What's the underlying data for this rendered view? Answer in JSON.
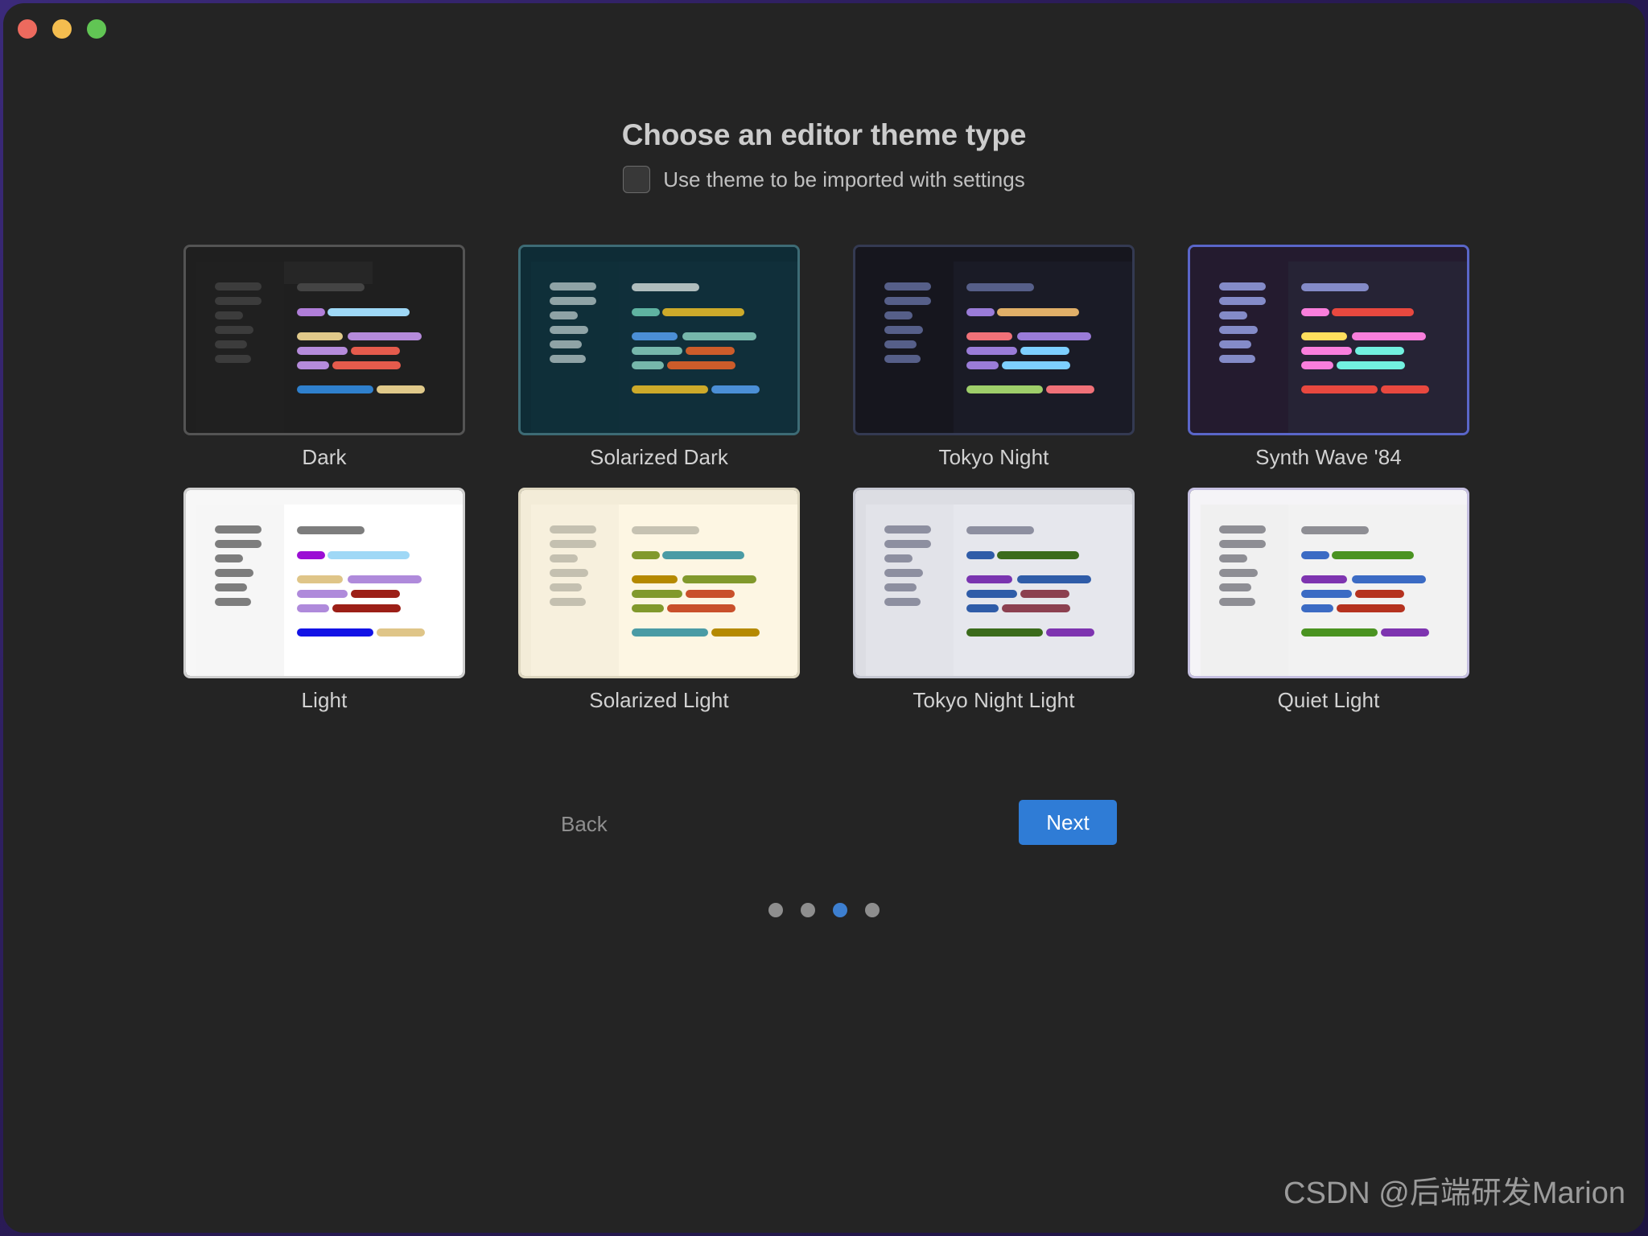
{
  "window": {
    "traffic_lights": [
      {
        "name": "close",
        "color": "#ed6a5e"
      },
      {
        "name": "minimize",
        "color": "#f4bd4f"
      },
      {
        "name": "zoom",
        "color": "#61c554"
      }
    ],
    "background": "#242424"
  },
  "header": {
    "title": "Choose an editor theme type",
    "import_label": "Use theme to be imported with settings",
    "import_checked": false
  },
  "themes": [
    {
      "label": "Dark",
      "selected": false,
      "chrome": false,
      "colors": {
        "bg": "#1f1f1f",
        "titlebar": "#1f1f1f",
        "activitybar": "#1f1f1f",
        "sidebar": "#202020",
        "editor": "#1f1f1f",
        "tab": "#262626",
        "line": "#2d2d2d",
        "border": "#545454",
        "sidebar_bar": "#3c3c3c",
        "tab_bar": "#444444"
      },
      "code": [
        [
          "#b07ed8",
          "#9fd8f6"
        ],
        [
          "#e0c98a",
          "#b58bdb"
        ],
        [
          "#b58bdb",
          "#e55b4c"
        ],
        [
          "#b58bdb",
          "#e55b4c"
        ],
        [
          "#2f80cd",
          "#e0c98a"
        ]
      ]
    },
    {
      "label": "Solarized Dark",
      "selected": false,
      "chrome": true,
      "colors": {
        "bg": "#10303b",
        "titlebar": "#0e2c36",
        "activitybar": "#0e2c36",
        "sidebar": "#0f2f39",
        "editor": "#102f3a",
        "tab": "#0e2c36",
        "line": "#204854",
        "border": "#3d6b75",
        "sidebar_bar": "#8fa3a6",
        "tab_bar": "#b0bdbd"
      },
      "code": [
        [
          "#5fb3a1",
          "#cdaa2a"
        ],
        [
          "#4b8fd6",
          "#76b7ab"
        ],
        [
          "#76b7ab",
          "#cc5c2a"
        ],
        [
          "#76b7ab",
          "#cc5c2a"
        ],
        [
          "#cdaa2a",
          "#4b8fd6"
        ]
      ]
    },
    {
      "label": "Tokyo Night",
      "selected": false,
      "chrome": true,
      "colors": {
        "bg": "#1a1b26",
        "titlebar": "#16161e",
        "activitybar": "#16161e",
        "sidebar": "#16161e",
        "editor": "#1a1b26",
        "tab": "#16161e",
        "line": "#2b2d3f",
        "border": "#343a52",
        "sidebar_bar": "#565f89",
        "tab_bar": "#565f89"
      },
      "code": [
        [
          "#9a7cd8",
          "#e0af68"
        ],
        [
          "#f07178",
          "#9a7cd8"
        ],
        [
          "#9a7cd8",
          "#7dcfff"
        ],
        [
          "#9a7cd8",
          "#7dcfff"
        ],
        [
          "#9ece6a",
          "#f07178"
        ]
      ]
    },
    {
      "label": "Synth Wave '84",
      "selected": true,
      "chrome": true,
      "colors": {
        "bg": "#262335",
        "titlebar": "#241b2f",
        "activitybar": "#241b2f",
        "sidebar": "#241b2f",
        "editor": "#262335",
        "tab": "#241b2f",
        "line": "#3a3350",
        "border": "#5a66c9",
        "sidebar_bar": "#848bc8",
        "tab_bar": "#848bc8"
      },
      "code": [
        [
          "#f97edc",
          "#e8483f"
        ],
        [
          "#fede5d",
          "#f97edc"
        ],
        [
          "#f97edc",
          "#72f1e0"
        ],
        [
          "#f97edc",
          "#72f1e0"
        ],
        [
          "#e8483f",
          "#e8483f"
        ]
      ]
    },
    {
      "label": "Light",
      "selected": false,
      "chrome": false,
      "colors": {
        "bg": "#f7f7f7",
        "titlebar": "#f7f7f7",
        "activitybar": "#f7f7f7",
        "sidebar": "#f6f6f6",
        "editor": "#ffffff",
        "tab": "#ffffff",
        "line": "#e8e8e8",
        "border": "#cfcfcf",
        "sidebar_bar": "#7d7d7d",
        "tab_bar": "#7d7d7d"
      },
      "code": [
        [
          "#9b0ed4",
          "#9fd8f6"
        ],
        [
          "#dfc588",
          "#af8adb"
        ],
        [
          "#af8adb",
          "#9c1f17"
        ],
        [
          "#af8adb",
          "#9c1f17"
        ],
        [
          "#1313e6",
          "#dfc588"
        ]
      ]
    },
    {
      "label": "Solarized Light",
      "selected": false,
      "chrome": true,
      "colors": {
        "bg": "#fdf6e3",
        "titlebar": "#f3ecd8",
        "activitybar": "#f3ecd8",
        "sidebar": "#f7f0dd",
        "editor": "#fdf6e3",
        "tab": "#f3ecd8",
        "line": "#e3dcc6",
        "border": "#ddd6bf",
        "sidebar_bar": "#c4c0b0",
        "tab_bar": "#c6c2b2"
      },
      "code": [
        [
          "#81992c",
          "#4a9ba5"
        ],
        [
          "#b58900",
          "#81992c"
        ],
        [
          "#81992c",
          "#c9502b"
        ],
        [
          "#81992c",
          "#c9502b"
        ],
        [
          "#4a9ba5",
          "#b58900"
        ]
      ]
    },
    {
      "label": "Tokyo Night Light",
      "selected": false,
      "chrome": true,
      "colors": {
        "bg": "#e6e7ed",
        "titlebar": "#dcdde3",
        "activitybar": "#dcdde3",
        "sidebar": "#e2e3e9",
        "editor": "#e6e7ed",
        "tab": "#dcdde3",
        "line": "#c9cad2",
        "border": "#c6c8d2",
        "sidebar_bar": "#8d8fa0",
        "tab_bar": "#8d8fa0"
      },
      "code": [
        [
          "#2f5ca8",
          "#3b6b1c"
        ],
        [
          "#7a34b0",
          "#2f5ca8"
        ],
        [
          "#2f5ca8",
          "#8c4050"
        ],
        [
          "#2f5ca8",
          "#8c4050"
        ],
        [
          "#3b6b1c",
          "#7e34b0"
        ]
      ]
    },
    {
      "label": "Quiet Light",
      "selected": false,
      "chrome": true,
      "colors": {
        "bg": "#f2f2f2",
        "titlebar": "#f5f4f7",
        "activitybar": "#f5f4f7",
        "sidebar": "#f0f0f0",
        "editor": "#f2f2f2",
        "tab": "#f5f4f7",
        "line": "#d8d8de",
        "border": "#c5bfe0",
        "sidebar_bar": "#8e8e94",
        "tab_bar": "#8e8e94"
      },
      "code": [
        [
          "#3b6bc4",
          "#4a9321"
        ],
        [
          "#7e34b0",
          "#3b6bc4"
        ],
        [
          "#3b6bc4",
          "#b5321f"
        ],
        [
          "#3b6bc4",
          "#b5321f"
        ],
        [
          "#4a9321",
          "#7e34b0"
        ]
      ]
    }
  ],
  "footer": {
    "back_label": "Back",
    "next_label": "Next",
    "next_color": "#2f7cd6",
    "dots": {
      "count": 4,
      "active_index": 2,
      "active_color": "#3d7fd0"
    }
  },
  "watermark": "CSDN @后端研发Marion"
}
